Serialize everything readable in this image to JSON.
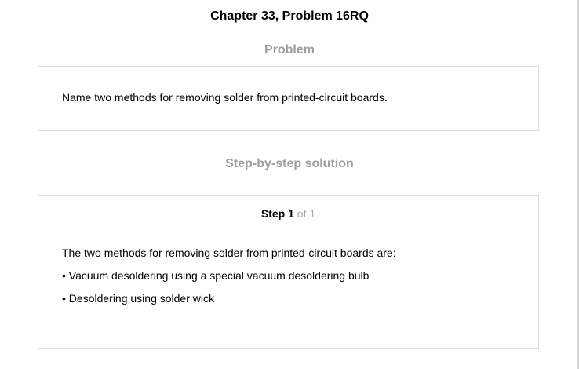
{
  "page": {
    "title": "Chapter 33, Problem 16RQ"
  },
  "problem": {
    "heading": "Problem",
    "text": "Name two methods for removing solder from printed-circuit boards."
  },
  "solution": {
    "heading": "Step-by-step solution",
    "step_label": "Step",
    "step_number": "1",
    "step_of": "of 1",
    "lines": [
      "The two methods for removing solder from printed-circuit boards are:",
      "• Vacuum desoldering using a special vacuum desoldering bulb",
      "• Desoldering using solder wick"
    ]
  },
  "colors": {
    "heading_gray": "#9e9e9e",
    "border_gray": "#dcdcdc",
    "step_of_gray": "#a8a8a8"
  }
}
